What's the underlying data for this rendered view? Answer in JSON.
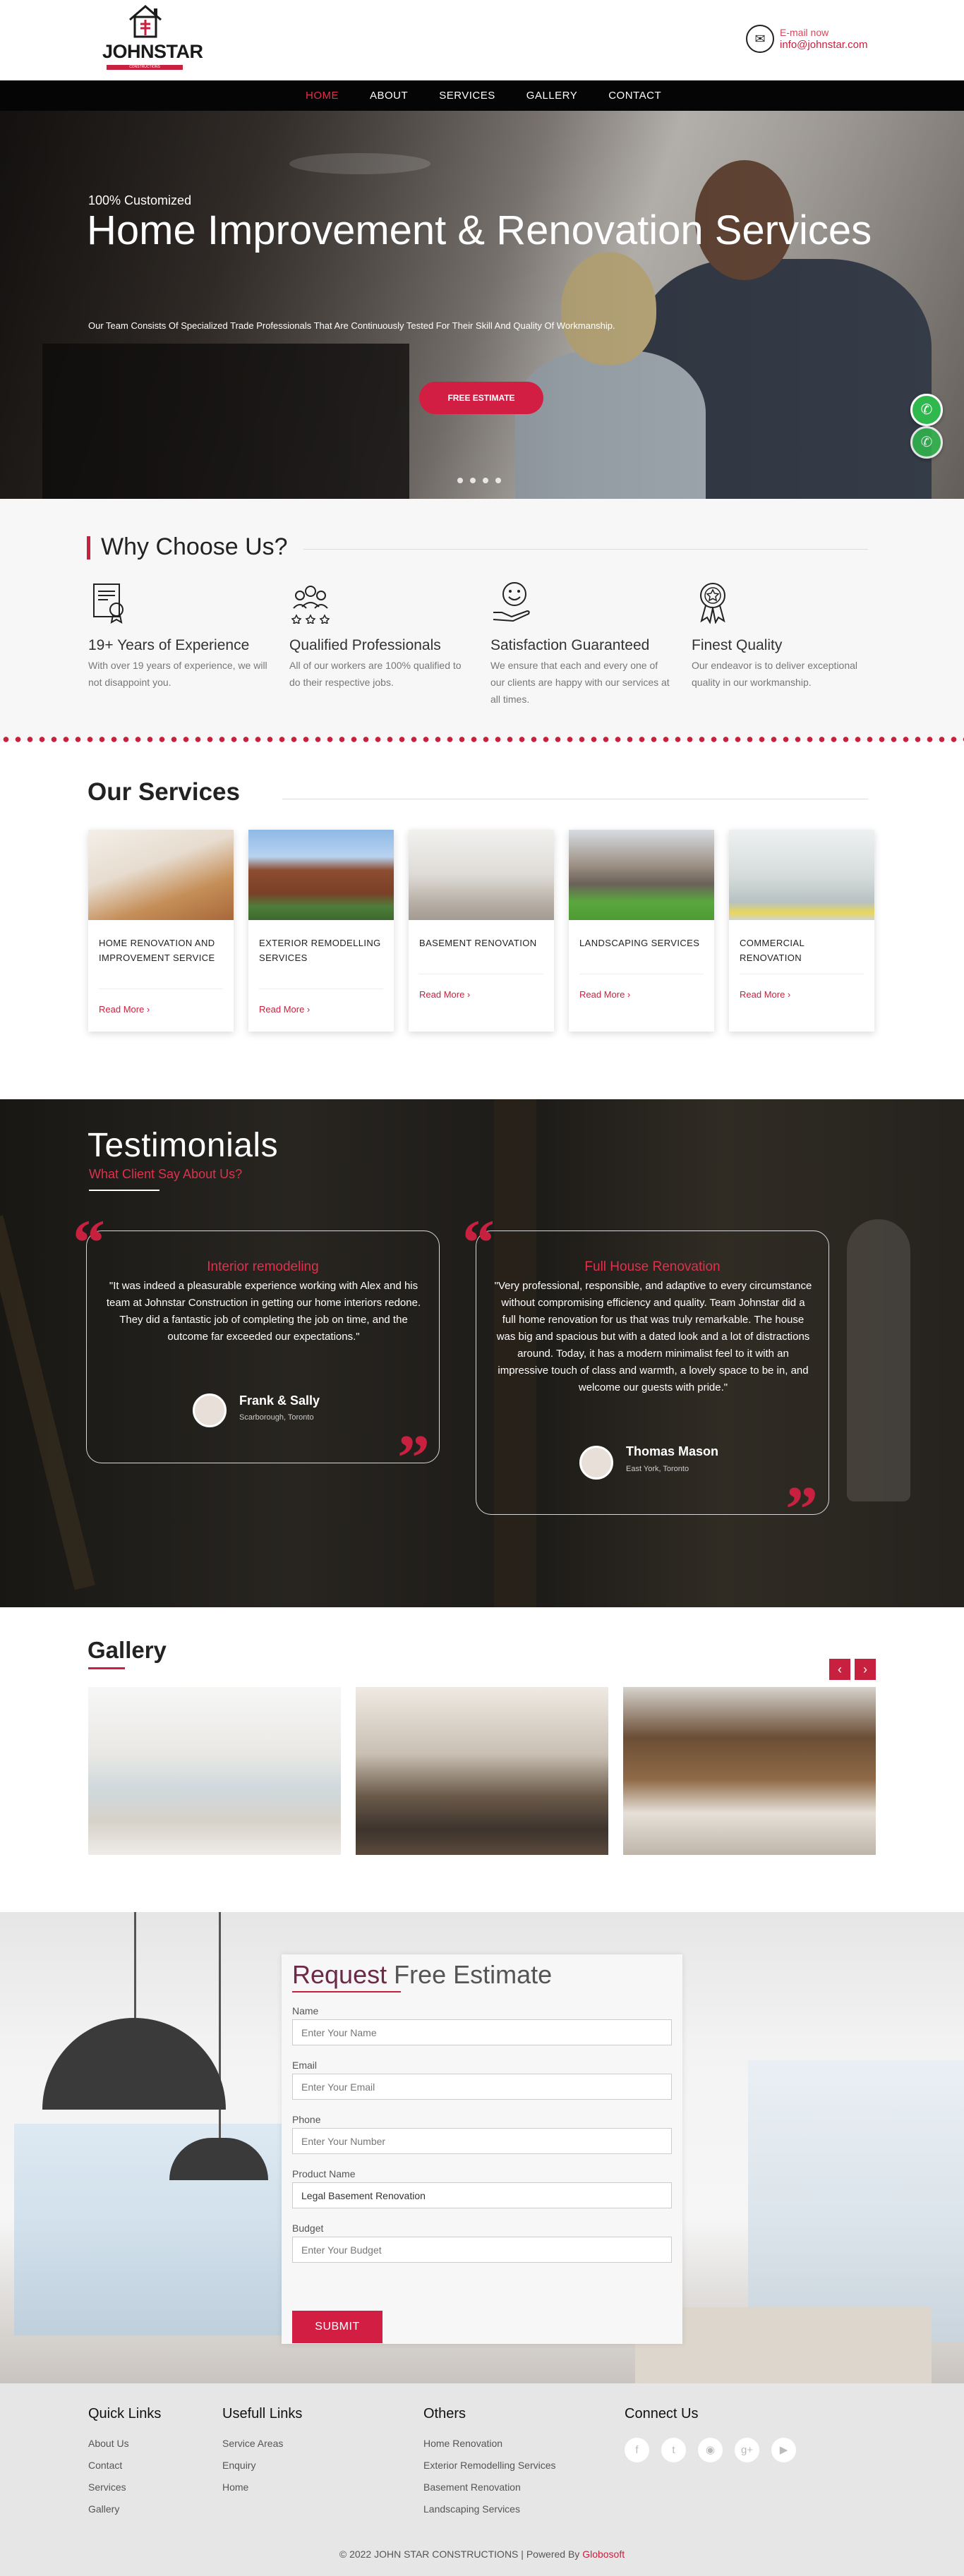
{
  "brand": {
    "name": "JOHNSTAR",
    "tagline": "CONSTRUCTIONS"
  },
  "contact": {
    "label": "E-mail now",
    "email": "info@johnstar.com"
  },
  "nav": [
    {
      "label": "HOME"
    },
    {
      "label": "ABOUT"
    },
    {
      "label": "SERVICES"
    },
    {
      "label": "GALLERY"
    },
    {
      "label": "CONTACT"
    }
  ],
  "hero": {
    "subtitle": "100% Customized",
    "title": "Home Improvement & Renovation Services",
    "description": "Our Team Consists Of Specialized Trade Professionals That Are Continuously Tested For Their Skill And Quality Of Workmanship.",
    "button": "FREE ESTIMATE",
    "slides": 4
  },
  "why": {
    "title": "Why Choose Us?",
    "features": [
      {
        "icon": "certificate-icon",
        "title": "19+ Years of Experience",
        "text": "With over 19 years of experience, we will not disappoint you."
      },
      {
        "icon": "team-stars-icon",
        "title": "Qualified Professionals",
        "text": "All of our workers are 100% qualified to do their respective jobs."
      },
      {
        "icon": "smiley-hand-icon",
        "title": "Satisfaction Guaranteed",
        "text": "We ensure that each and every one of our clients are happy with our services at all times."
      },
      {
        "icon": "medal-icon",
        "title": "Finest Quality",
        "text": "Our endeavor is to deliver exceptional quality in our workmanship."
      }
    ]
  },
  "services": {
    "title": "Our Services",
    "read_more": "Read More ›",
    "items": [
      {
        "title": "HOME RENOVATION AND IMPROVEMENT SERVICE"
      },
      {
        "title": "EXTERIOR REMODELLING SERVICES"
      },
      {
        "title": "BASEMENT RENOVATION"
      },
      {
        "title": "LANDSCAPING SERVICES"
      },
      {
        "title": "COMMERCIAL RENOVATION"
      }
    ]
  },
  "testimonials": {
    "title": "Testimonials",
    "subtitle": "What Client Say About Us?",
    "items": [
      {
        "heading": "Interior remodeling",
        "text": "\"It was indeed a pleasurable experience working with Alex and his team at Johnstar Construction in getting our home interiors redone. They did a fantastic job of completing the job on time, and the outcome far exceeded our expectations.\"",
        "name": "Frank & Sally",
        "location": "Scarborough, Toronto"
      },
      {
        "heading": "Full House Renovation",
        "text": "\"Very professional, responsible, and adaptive to every circumstance without compromising efficiency and quality. Team Johnstar did a full home renovation for us that was truly remarkable. The house was big and spacious but with a dated look and a lot of distractions around. Today, it has a modern minimalist feel to it with an impressive touch of class and warmth, a lovely space to be in, and welcome our guests with pride.\"",
        "name": "Thomas Mason",
        "location": "East York, Toronto"
      }
    ]
  },
  "gallery": {
    "title": "Gallery",
    "prev": "‹",
    "next": "›"
  },
  "estimate": {
    "title_a": "Request",
    "title_b": " Free Estimate",
    "fields": [
      {
        "label": "Name",
        "placeholder": "Enter Your Name",
        "value": ""
      },
      {
        "label": "Email",
        "placeholder": "Enter Your Email",
        "value": ""
      },
      {
        "label": "Phone",
        "placeholder": "Enter Your Number",
        "value": ""
      },
      {
        "label": "Product Name",
        "placeholder": "",
        "value": "Legal Basement Renovation"
      },
      {
        "label": "Budget",
        "placeholder": "Enter Your Budget",
        "value": ""
      }
    ],
    "submit": "SUBMIT"
  },
  "footer": {
    "quick": {
      "title": "Quick Links",
      "items": [
        "About Us",
        "Contact",
        "Services",
        "Gallery"
      ]
    },
    "useful": {
      "title": "Usefull Links",
      "items": [
        "Service Areas",
        "Enquiry",
        "Home"
      ]
    },
    "others": {
      "title": "Others",
      "items": [
        "Home Renovation",
        "Exterior Remodelling Services",
        "Basement Renovation",
        "Landscaping Services"
      ]
    },
    "connect": {
      "title": "Connect Us",
      "icons": [
        "facebook-icon",
        "twitter-icon",
        "rss-icon",
        "google-plus-icon",
        "youtube-icon"
      ]
    },
    "copyright": "© 2022 JOHN STAR CONSTRUCTIONS | Powered By ",
    "powered": "Globosoft"
  },
  "colors": {
    "accent": "#c8213f",
    "nav_bg": "#050505",
    "whatsapp": "#2fb84d"
  }
}
